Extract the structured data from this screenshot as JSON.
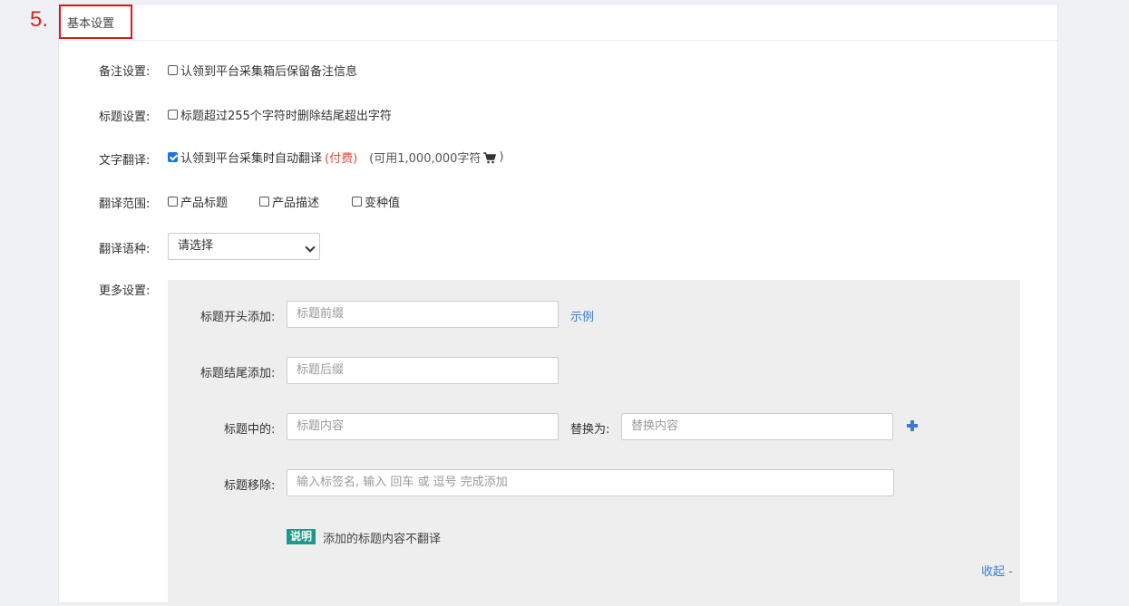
{
  "step_number": "5.",
  "section_title": "基本设置",
  "remark": {
    "label": "备注设置:",
    "checkbox_label": "认领到平台采集箱后保留备注信息",
    "checked": false
  },
  "title_setting": {
    "label": "标题设置:",
    "checkbox_label": "标题超过255个字符时删除结尾超出字符",
    "checked": false
  },
  "text_translate": {
    "label": "文字翻译:",
    "checkbox_label": "认领到平台采集时自动翻译",
    "paid_note": "(付费)",
    "available_note": "(可用1,000,000字符",
    "available_close": ")",
    "cart_icon": "cart-icon",
    "checked": true
  },
  "translate_scope": {
    "label": "翻译范围:",
    "options": [
      {
        "label": "产品标题",
        "checked": false
      },
      {
        "label": "产品描述",
        "checked": false
      },
      {
        "label": "变种值",
        "checked": false
      }
    ]
  },
  "translate_lang": {
    "label": "翻译语种:",
    "selected": "请选择"
  },
  "more_settings": {
    "label": "更多设置:",
    "prefix_label": "标题开头添加:",
    "prefix_placeholder": "标题前缀",
    "example_link": "示例",
    "suffix_label": "标题结尾添加:",
    "suffix_placeholder": "标题后缀",
    "contains_label": "标题中的:",
    "contains_placeholder": "标题内容",
    "replace_label": "替换为:",
    "replace_placeholder": "替换内容",
    "remove_label": "标题移除:",
    "remove_placeholder": "输入标签名, 输入 回车 或 逗号 完成添加",
    "note_tag": "说明",
    "note_text": "添加的标题内容不翻译",
    "collapse_link": "收起 -"
  },
  "colors": {
    "accent_blue": "#3a7bd5",
    "paid_red": "#e24a3b",
    "highlight_red": "#e0161e",
    "tag_teal": "#1b9a8c"
  }
}
